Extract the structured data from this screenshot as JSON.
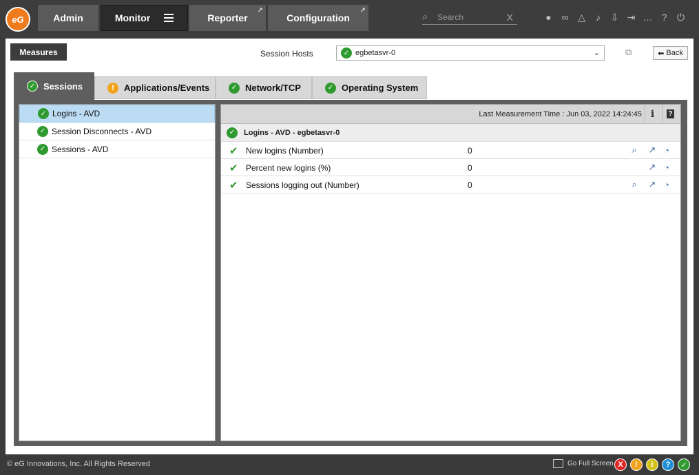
{
  "nav": {
    "logo_text": "eG",
    "tabs": [
      {
        "label": "Admin"
      },
      {
        "label": "Monitor"
      },
      {
        "label": "Reporter"
      },
      {
        "label": "Configuration"
      }
    ],
    "search_placeholder": "Search",
    "search_clear": "X"
  },
  "toolbar": {
    "measures_label": "Measures",
    "session_hosts_label": "Session Hosts",
    "selected_host": "egbetasvr-0",
    "back_label": "Back"
  },
  "tabs": [
    {
      "label": "Sessions",
      "status": "ok"
    },
    {
      "label": "Applications/Events",
      "status": "warning"
    },
    {
      "label": "Network/TCP",
      "status": "ok"
    },
    {
      "label": "Operating System",
      "status": "ok"
    }
  ],
  "tests": [
    {
      "label": "Logins - AVD",
      "selected": true
    },
    {
      "label": "Session Disconnects - AVD",
      "selected": false
    },
    {
      "label": "Sessions - AVD",
      "selected": false
    }
  ],
  "measurements": {
    "last_time": "Last Measurement Time : Jun 03, 2022 14:24:45",
    "info_icon": "i",
    "help_icon": "?",
    "group_title": "Logins - AVD - egbetasvr-0",
    "rows": [
      {
        "name": "New logins (Number)",
        "value": "0"
      },
      {
        "name": "Percent new logins (%)",
        "value": "0"
      },
      {
        "name": "Sessions logging out (Number)",
        "value": "0"
      }
    ]
  },
  "footer": {
    "copyright": "© eG Innovations, Inc. All Rights Reserved",
    "fullscreen_label": "Go Full Screen",
    "status_icons": [
      "X",
      "!",
      "i",
      "?",
      "✓"
    ]
  },
  "colors": {
    "ok": "#2f9a2f",
    "warning": "#f2a31d",
    "critical": "#e02424",
    "info": "#1e8fd6",
    "brand": "#f07b1c"
  }
}
